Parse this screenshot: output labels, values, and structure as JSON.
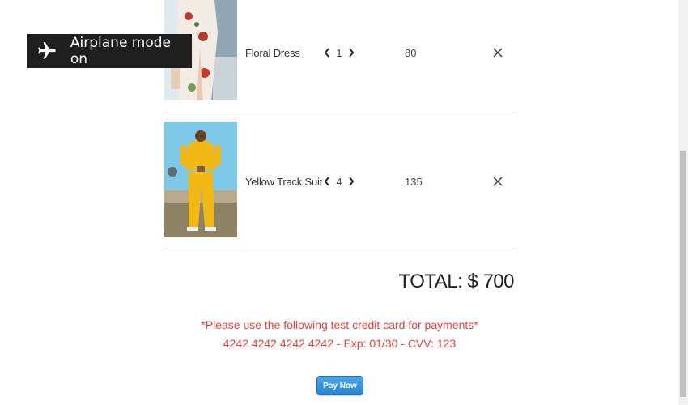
{
  "toast": {
    "label": "Airplane mode on",
    "icon": "airplane-icon"
  },
  "cart": {
    "items": [
      {
        "name": "Floral Dress",
        "quantity": "1",
        "price": "80"
      },
      {
        "name": "Yellow Track Suit",
        "quantity": "4",
        "price": "135"
      }
    ]
  },
  "total": "TOTAL: $ 700",
  "payment_note": {
    "line1": "*Please use the following test credit card for payments*",
    "line2": "4242 4242 4242 4242 - Exp: 01/30 - CVV: 123"
  },
  "pay_button": {
    "label": "Pay Now"
  },
  "colors": {
    "note_red": "#e8413a",
    "pay_blue": "#2a86d1",
    "toast_bg": "#1f1f1f"
  }
}
